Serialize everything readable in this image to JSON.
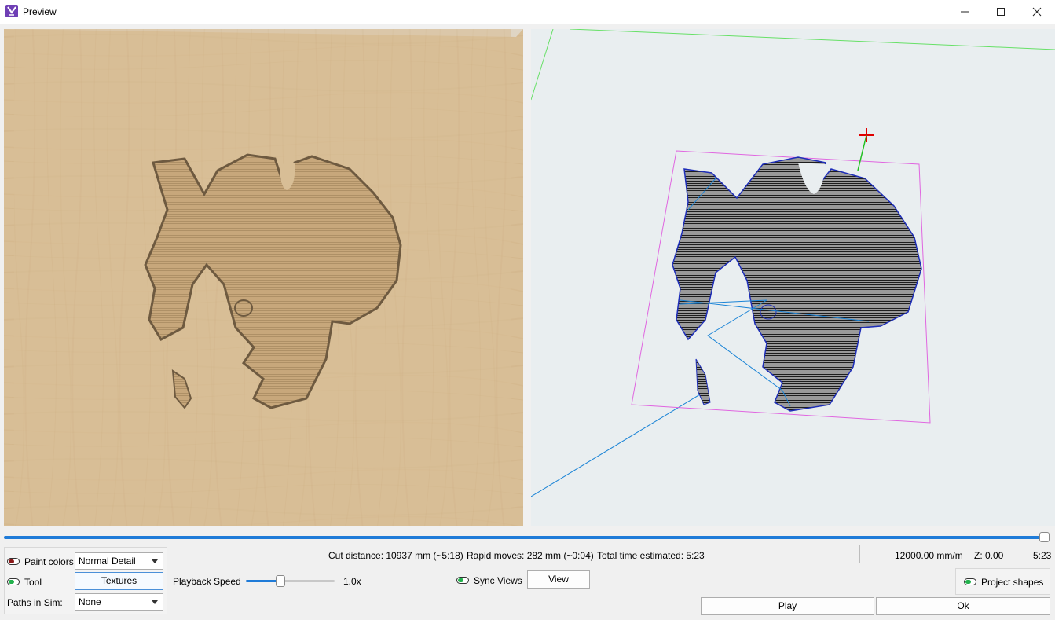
{
  "window": {
    "title": "Preview",
    "minimize_icon": "minimize-icon",
    "maximize_icon": "maximize-icon",
    "close_icon": "close-icon"
  },
  "timeline": {
    "progress": 1.0
  },
  "controls": {
    "paint_colors": {
      "label": "Paint colors",
      "enabled": false,
      "detail_value": "Normal Detail"
    },
    "tool": {
      "label": "Tool",
      "enabled": true,
      "textures_label": "Textures"
    },
    "paths_in_sim": {
      "label": "Paths in Sim:",
      "value": "None"
    },
    "playback": {
      "label": "Playback Speed",
      "value_text": "1.0x",
      "value": 1.0
    },
    "sync_views": {
      "label": "Sync Views",
      "enabled": true,
      "view_label": "View"
    },
    "project_shapes": {
      "label": "Project shapes",
      "enabled": true
    },
    "play_label": "Play",
    "ok_label": "Ok"
  },
  "stats": {
    "cut_distance": "Cut distance: 10937 mm (~5:18)",
    "rapid_moves": "Rapid moves: 282 mm (~0:04)",
    "total_time": "Total time estimated: 5:23",
    "feed_rate": "12000.00 mm/m",
    "z": "Z: 0.00",
    "time": "5:23"
  },
  "colors": {
    "accent": "#1f7bd8",
    "wood": "#d9bf97",
    "bounding_box": "#e066e0",
    "rapid_path": "#1b84d6"
  }
}
